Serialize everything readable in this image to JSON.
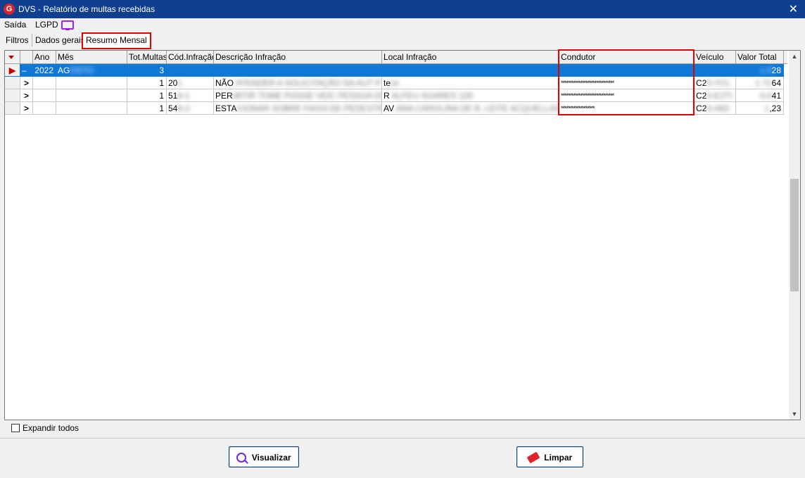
{
  "window": {
    "title": "DVS - Relatório de multas recebidas",
    "close_icon": "close-icon"
  },
  "menu": {
    "saida": "Saída",
    "lgpd": "LGPD"
  },
  "tabs": [
    {
      "label": "Filtros"
    },
    {
      "label": "Dados gerais"
    },
    {
      "label": "Resumo Mensal"
    }
  ],
  "grid": {
    "columns": {
      "ano": "Ano",
      "mes": "Mês",
      "tot_multas": "Tot.Multas",
      "cod_infracao": "Cód.Infração",
      "descricao": "Descrição Infração",
      "local": "Local Infração",
      "condutor": "Condutor",
      "veiculo": "Veículo",
      "valor_total": "Valor Total"
    },
    "rows": [
      {
        "indicator": "–",
        "expander": "",
        "ano": "2022",
        "mes": "AG",
        "mes_blurred": "OSTO",
        "tot": "3",
        "cod": "",
        "cod_blurred": "",
        "desc": "",
        "desc_blurred": "",
        "local": "",
        "local_blurred": "",
        "condutor": "",
        "veiculo": "",
        "veiculo_blurred": "",
        "valor_blurred": "1.0",
        "valor": "28"
      },
      {
        "indicator": "",
        "expander": ">",
        "ano": "",
        "mes": "",
        "mes_blurred": "",
        "tot": "1",
        "cod": "20",
        "cod_blurred": "1",
        "desc": "NÃO",
        "desc_blurred": " ATENDER A SOLICITAÇÃO DA AUT P.",
        "local": "te",
        "local_blurred": "xx",
        "condutor": "******************************",
        "veiculo": "C2",
        "veiculo_blurred": "0-YCL",
        "valor_blurred": "1.72",
        "valor": "64"
      },
      {
        "indicator": "",
        "expander": ">",
        "ano": "",
        "mes": "",
        "mes_blurred": "",
        "tot": "1",
        "cod": "51",
        "cod_blurred": "8-1",
        "desc": "PER",
        "desc_blurred": "MITIR TOME POSSE VEIC PESSOA DIVA",
        "local": "R",
        "local_blurred": " ALFEU SOARES 128",
        "condutor": "******************************",
        "veiculo": "C2",
        "veiculo_blurred": "0-E2TI",
        "valor_blurred": "0.6",
        "valor": "41"
      },
      {
        "indicator": "",
        "expander": ">",
        "ano": "",
        "mes": "",
        "mes_blurred": "",
        "tot": "1",
        "cod": "54",
        "cod_blurred": "6-2",
        "desc": "ESTA",
        "desc_blurred": "CIONAR SOBRE FAIXA DE PEDESTRES",
        "local": "AV",
        "local_blurred": " ANA CAROLINA DE B. LEITE ACQUELLANE",
        "local_tail": "...",
        "condutor": "*******************",
        "veiculo": "C2",
        "veiculo_blurred": "0-A82",
        "valor_blurred": "1",
        "valor": ",23"
      }
    ]
  },
  "expand_all": {
    "label": "Expandir todos",
    "checked": false
  },
  "buttons": {
    "visualizar": {
      "label": "Visualizar",
      "icon": "magnifier-icon"
    },
    "limpar": {
      "label": "Limpar",
      "icon": "eraser-icon"
    }
  },
  "colors": {
    "titlebar": "#0f3f8e",
    "selection": "#0f78d7",
    "highlight_box": "#e00000",
    "icon_purple": "#a020f0"
  }
}
